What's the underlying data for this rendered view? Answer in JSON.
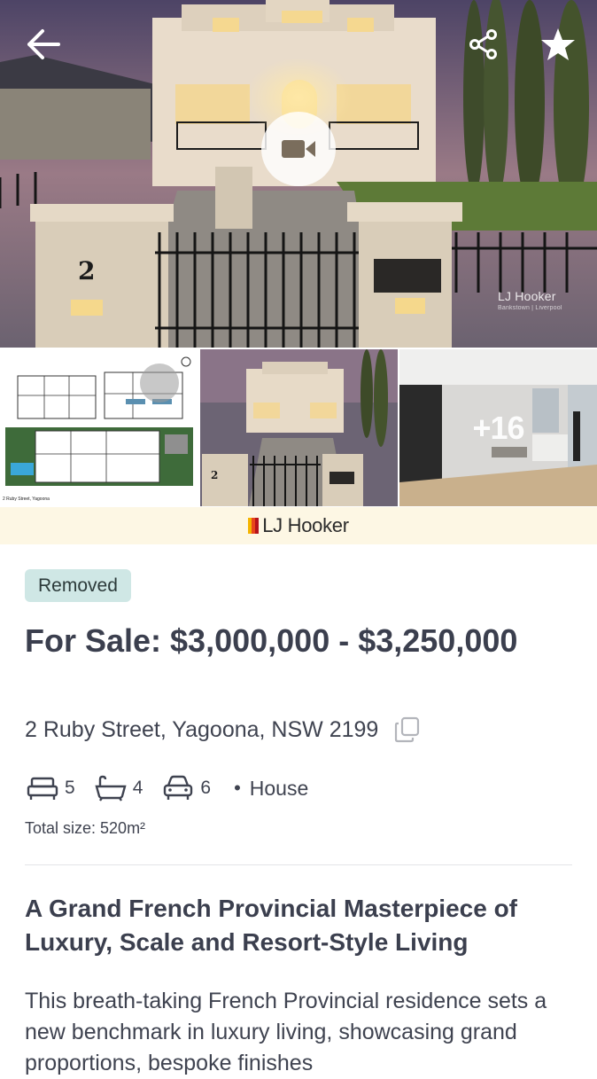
{
  "gallery": {
    "watermark_brand": "LJ Hooker",
    "watermark_sub": "Bankstown | Liverpool",
    "more_photos": "+16",
    "floorplan_caption": "2 Ruby Street, Yagoona",
    "front_house_number": "2"
  },
  "agency": {
    "name": "LJ Hooker",
    "brand_colors": [
      "#f4b400",
      "#e8461b",
      "#b5121b"
    ]
  },
  "listing": {
    "status": "Removed",
    "price": "For Sale: $3,000,000 - $3,250,000",
    "address": "2 Ruby Street, Yagoona, NSW 2199",
    "bedrooms": "5",
    "bathrooms": "4",
    "parking": "6",
    "property_type": "House",
    "total_size": "Total size: 520m²",
    "headline": "A Grand French Provincial Masterpiece of Luxury, Scale and Resort-Style Living",
    "description": "This breath-taking French Provincial residence sets a new benchmark in luxury living, showcasing grand proportions, bespoke finishes"
  },
  "icons": {
    "back": "arrow-left-icon",
    "share": "share-icon",
    "favourite": "star-icon",
    "video": "video-camera-icon",
    "copy": "copy-icon",
    "bed": "bed-icon",
    "bath": "bath-icon",
    "car": "car-icon"
  },
  "colors": {
    "status_badge_bg": "#cfe7e5",
    "agency_banner_bg": "#fdf7e4",
    "text": "#3b3f4e"
  }
}
